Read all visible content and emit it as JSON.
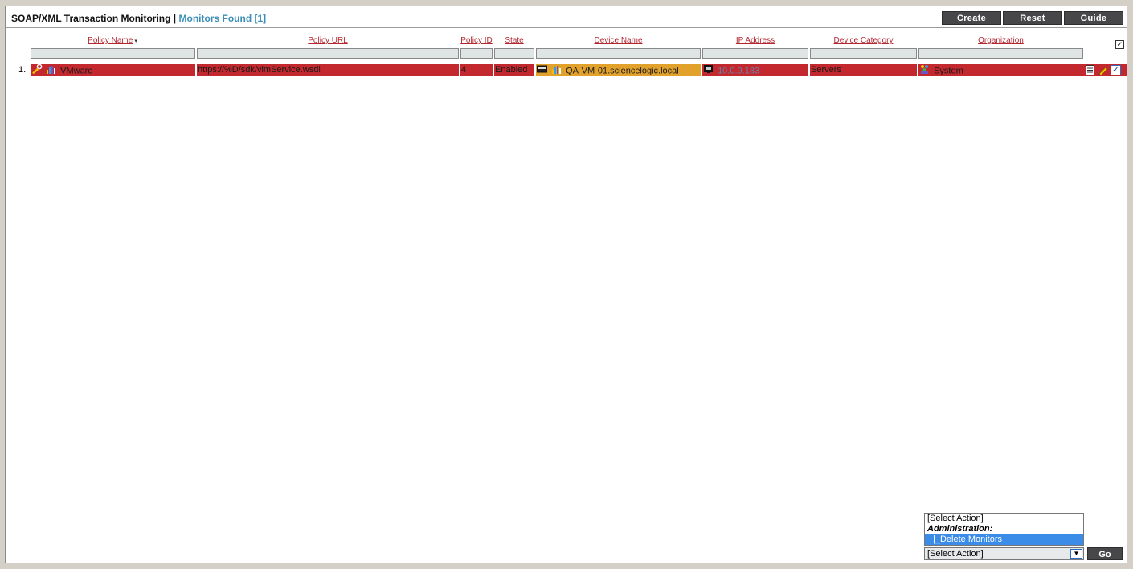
{
  "header": {
    "title": "SOAP/XML Transaction Monitoring |",
    "count_label": "Monitors Found [1]",
    "buttons": {
      "create": "Create",
      "reset": "Reset",
      "guide": "Guide"
    }
  },
  "columns": {
    "policy_name": "Policy Name",
    "policy_url": "Policy URL",
    "policy_id": "Policy ID",
    "state": "State",
    "device_name": "Device Name",
    "ip_address": "IP Address",
    "device_category": "Device Category",
    "organization": "Organization"
  },
  "sort_indicator": "▾",
  "select_all_mark": "✓",
  "rows": [
    {
      "num": "1.",
      "policy_name": "VMware",
      "policy_url": "https://%D/sdk/vimService.wsdl",
      "policy_id": "4",
      "state": "Enabled",
      "device_name": "QA-VM-01.sciencelogic.local",
      "ip_address": "10.0.9.183",
      "device_category": "Servers",
      "organization": "System",
      "checked_mark": "✓"
    }
  ],
  "colors": {
    "row_highlight": "#c2282e",
    "device_highlight": "#e2a12b",
    "link": "#b32730",
    "accent": "#3b8fb7"
  },
  "action_menu": {
    "options": [
      "[Select Action]",
      "Administration:",
      "|_Delete Monitors"
    ],
    "selected": "[Select Action]",
    "arrow": "▼",
    "go_label": "Go"
  }
}
